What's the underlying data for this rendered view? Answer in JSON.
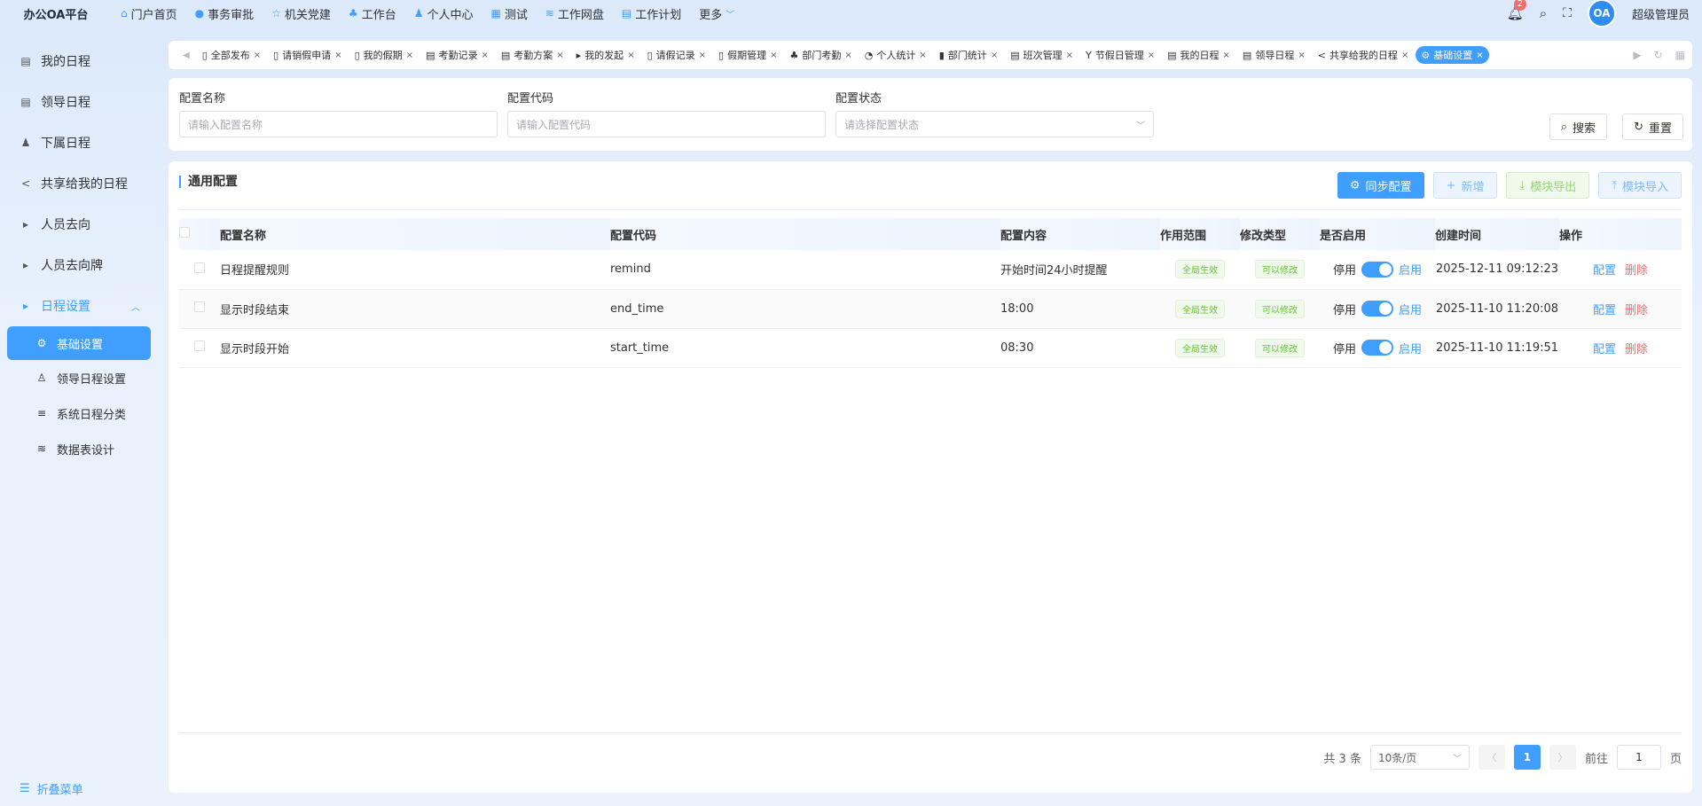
{
  "brand": "办公OA平台",
  "topnav": [
    {
      "icon": "home-icon",
      "glyph": "⌂",
      "label": "门户首页"
    },
    {
      "icon": "clock-icon",
      "glyph": "●",
      "label": "事务审批"
    },
    {
      "icon": "star-icon",
      "glyph": "☆",
      "label": "机关党建"
    },
    {
      "icon": "org-icon",
      "glyph": "♣",
      "label": "工作台"
    },
    {
      "icon": "user-icon",
      "glyph": "♟",
      "label": "个人中心"
    },
    {
      "icon": "grid-icon",
      "glyph": "▦",
      "label": "测试"
    },
    {
      "icon": "database-icon",
      "glyph": "≋",
      "label": "工作网盘"
    },
    {
      "icon": "calendar-icon",
      "glyph": "▤",
      "label": "工作计划"
    },
    {
      "icon": "chevron-down-icon",
      "glyph": "",
      "label": "更多"
    }
  ],
  "header": {
    "notification_count": "2",
    "avatar_text": "OA",
    "username": "超级管理员"
  },
  "sidebar": {
    "items": [
      {
        "label": "我的日程",
        "glyph": "▤"
      },
      {
        "label": "领导日程",
        "glyph": "▤"
      },
      {
        "label": "下属日程",
        "glyph": "♟"
      },
      {
        "label": "共享给我的日程",
        "glyph": "<"
      },
      {
        "label": "人员去向",
        "glyph": "▸"
      },
      {
        "label": "人员去向牌",
        "glyph": "▸"
      },
      {
        "label": "日程设置",
        "glyph": "▸"
      }
    ],
    "sub_items": [
      {
        "label": "基础设置",
        "glyph": "⚙"
      },
      {
        "label": "领导日程设置",
        "glyph": "♙"
      },
      {
        "label": "系统日程分类",
        "glyph": "≡"
      },
      {
        "label": "数据表设计",
        "glyph": "≋"
      }
    ],
    "collapse_label": "折叠菜单"
  },
  "tabs": [
    {
      "label": "全部发布",
      "glyph": "▯"
    },
    {
      "label": "请销假申请",
      "glyph": "▯"
    },
    {
      "label": "我的假期",
      "glyph": "▯"
    },
    {
      "label": "考勤记录",
      "glyph": "▤"
    },
    {
      "label": "考勤方案",
      "glyph": "▤"
    },
    {
      "label": "我的发起",
      "glyph": "▸"
    },
    {
      "label": "请假记录",
      "glyph": "▯"
    },
    {
      "label": "假期管理",
      "glyph": "▯"
    },
    {
      "label": "部门考勤",
      "glyph": "♣"
    },
    {
      "label": "个人统计",
      "glyph": "◔"
    },
    {
      "label": "部门统计",
      "glyph": "▮"
    },
    {
      "label": "班次管理",
      "glyph": "▤"
    },
    {
      "label": "节假日管理",
      "glyph": "Y"
    },
    {
      "label": "我的日程",
      "glyph": "▤"
    },
    {
      "label": "领导日程",
      "glyph": "▤"
    },
    {
      "label": "共享给我的日程",
      "glyph": "<"
    },
    {
      "label": "基础设置",
      "glyph": "⚙"
    }
  ],
  "search": {
    "name_label": "配置名称",
    "name_placeholder": "请输入配置名称",
    "code_label": "配置代码",
    "code_placeholder": "请输入配置代码",
    "status_label": "配置状态",
    "status_placeholder": "请选择配置状态",
    "search_button": "搜索",
    "reset_button": "重置"
  },
  "panel": {
    "title": "通用配置",
    "sync_button": "同步配置",
    "add_button": "新增",
    "export_button": "模块导出",
    "import_button": "模块导入"
  },
  "table": {
    "columns": [
      "配置名称",
      "配置代码",
      "配置内容",
      "作用范围",
      "修改类型",
      "是否启用",
      "创建时间",
      "操作"
    ],
    "rows": [
      {
        "name": "日程提醒规则",
        "code": "remind",
        "content": "开始时间24小时提醒",
        "scope": "全局生效",
        "modify": "可以修改",
        "off": "停用",
        "on": "启用",
        "created": "2025-12-11 09:12:23",
        "action_config": "配置",
        "action_delete": "删除"
      },
      {
        "name": "显示时段结束",
        "code": "end_time",
        "content": "18:00",
        "scope": "全局生效",
        "modify": "可以修改",
        "off": "停用",
        "on": "启用",
        "created": "2025-11-10 11:20:08",
        "action_config": "配置",
        "action_delete": "删除"
      },
      {
        "name": "显示时段开始",
        "code": "start_time",
        "content": "08:30",
        "scope": "全局生效",
        "modify": "可以修改",
        "off": "停用",
        "on": "启用",
        "created": "2025-11-10 11:19:51",
        "action_config": "配置",
        "action_delete": "删除"
      }
    ]
  },
  "pagination": {
    "total": "共 3 条",
    "page_size": "10条/页",
    "current_page": "1",
    "goto_label": "前往",
    "goto_value": "1",
    "page_suffix": "页"
  }
}
